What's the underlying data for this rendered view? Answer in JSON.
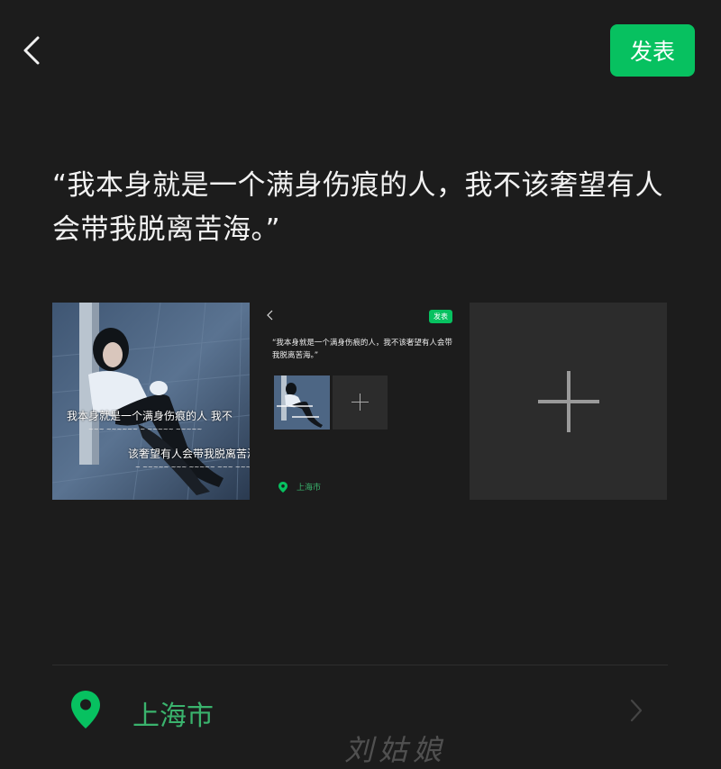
{
  "header": {
    "back_icon": "chevron-left-icon",
    "publish_label": "发表",
    "accent_color": "#07c160"
  },
  "post": {
    "text": "“我本身就是一个满身伤痕的人，我不该奢望有人会带我脱离苦海。”"
  },
  "images": [
    {
      "type": "photo",
      "overlay_caption_1": "我本身就是一个满身伤痕的人 我不",
      "overlay_caption_2": "该奢望有人会带我脱离苦海"
    },
    {
      "type": "screenshot",
      "mini_publish_label": "发表",
      "mini_text": "“我本身就是一个满身伤痕的人，我不该奢望有人会带我脱离苦海。”",
      "mini_location": "上海市"
    },
    {
      "type": "add-button",
      "icon": "plus-icon"
    }
  ],
  "location": {
    "icon": "location-pin-icon",
    "label": "上海市",
    "label_color": "#3ab36d",
    "chevron_icon": "chevron-right-icon"
  },
  "watermark": {
    "text": "刘姑娘"
  }
}
